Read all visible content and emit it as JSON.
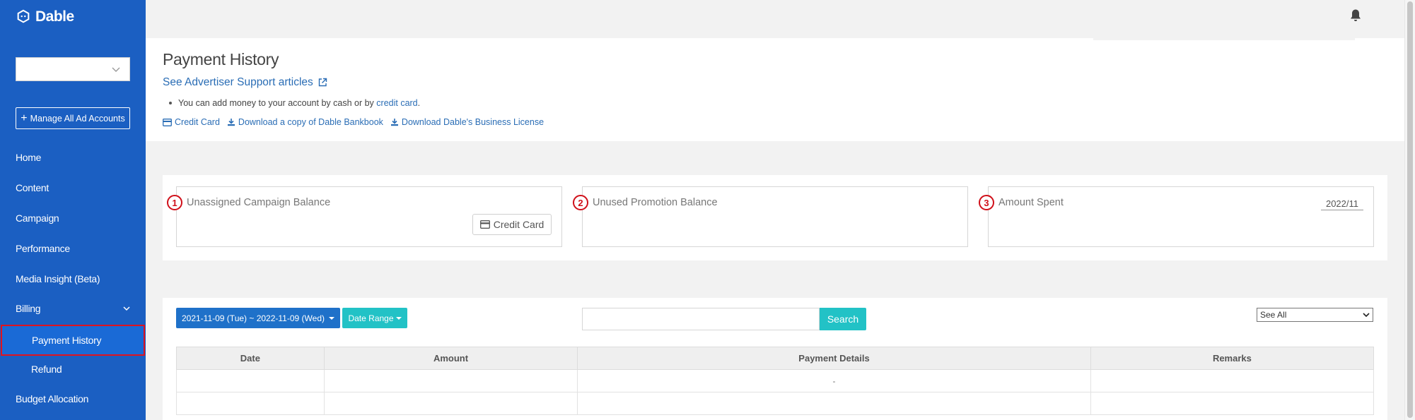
{
  "sidebar": {
    "brand": "Dable",
    "account_select_value": "",
    "manage_label": "Manage All Ad Accounts",
    "items": [
      {
        "label": "Home"
      },
      {
        "label": "Content"
      },
      {
        "label": "Campaign"
      },
      {
        "label": "Performance"
      },
      {
        "label": "Media Insight (Beta)"
      },
      {
        "label": "Billing"
      },
      {
        "label": "Payment History"
      },
      {
        "label": "Refund"
      },
      {
        "label": "Budget Allocation"
      }
    ]
  },
  "header": {
    "title": "Payment History",
    "support_link": "See Advertiser Support articles",
    "note_prefix": "You can add money to your account by cash or by ",
    "note_link": "credit card",
    "note_suffix": ".",
    "links": [
      "Credit Card",
      "Download a copy of Dable Bankbook",
      "Download Dable's Business License"
    ]
  },
  "balance_cards": [
    {
      "number": "1",
      "label": "Unassigned Campaign Balance",
      "button": "Credit Card"
    },
    {
      "number": "2",
      "label": "Unused Promotion Balance"
    },
    {
      "number": "3",
      "label": "Amount Spent",
      "month": "2022/11"
    }
  ],
  "filters": {
    "date_range": "2021-11-09 (Tue)  ~  2022-11-09 (Wed)",
    "range_button": "Date Range",
    "search_value": "",
    "search_button": "Search",
    "view_select": "See All"
  },
  "table": {
    "columns": [
      "Date",
      "Amount",
      "Payment Details",
      "Remarks"
    ],
    "rows": [
      [
        "",
        "",
        "-",
        ""
      ],
      [
        "",
        "",
        "",
        ""
      ]
    ]
  },
  "colors": {
    "sidebar": "#1b5fc2",
    "active_outline": "#e0131e",
    "primary_button": "#1f71c9",
    "teal_button": "#22c2c6",
    "link": "#2a6db5",
    "badge_red": "#d0101a"
  }
}
